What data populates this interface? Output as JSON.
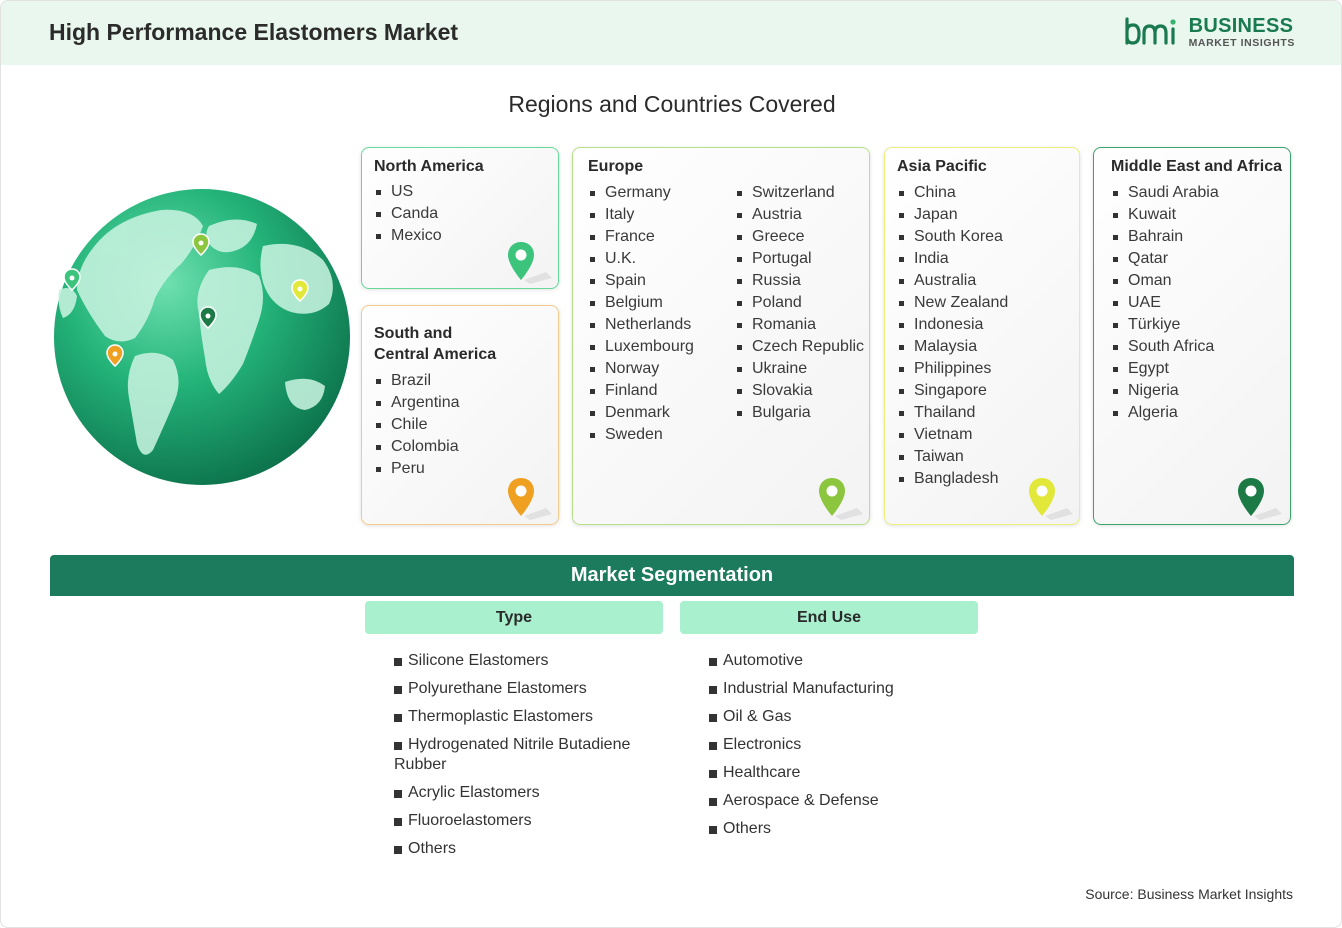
{
  "header": {
    "title": "High Performance Elastomers Market",
    "logo_line1": "BUSINESS",
    "logo_line2": "MARKET INSIGHTS",
    "logo_mark": "bmi"
  },
  "regions_title": "Regions and Countries Covered",
  "regions": {
    "north_america": {
      "title": "North America",
      "items": [
        "US",
        "Canda",
        "Mexico"
      ],
      "pin_color": "#3cc47c"
    },
    "south_america": {
      "title_line1": "South and",
      "title_line2": "Central America",
      "items": [
        "Brazil",
        "Argentina",
        "Chile",
        "Colombia",
        "Peru"
      ],
      "pin_color": "#f0a020"
    },
    "europe": {
      "title": "Europe",
      "col1": [
        "Germany",
        "Italy",
        "France",
        "U.K.",
        "Spain",
        "Belgium",
        "Netherlands",
        "Luxembourg",
        "Norway",
        "Finland",
        "Denmark",
        "Sweden"
      ],
      "col2": [
        "Switzerland",
        "Austria",
        "Greece",
        "Portugal",
        "Russia",
        "Poland",
        "Romania",
        "Czech Republic",
        "Ukraine",
        "Slovakia",
        "Bulgaria"
      ],
      "pin_color": "#8cc63f"
    },
    "asia_pacific": {
      "title": "Asia Pacific",
      "items": [
        "China",
        "Japan",
        "South Korea",
        "India",
        "Australia",
        "New Zealand",
        "Indonesia",
        "Malaysia",
        "Philippines",
        "Singapore",
        "Thailand",
        "Vietnam",
        "Taiwan",
        "Bangladesh"
      ],
      "pin_color": "#e2e83a"
    },
    "mea": {
      "title": "Middle East and Africa",
      "items": [
        "Saudi Arabia",
        "Kuwait",
        "Bahrain",
        "Qatar",
        "Oman",
        "UAE",
        "Türkiye",
        "South Africa",
        "Egypt",
        "Nigeria",
        "Algeria"
      ],
      "pin_color": "#1b7a45"
    }
  },
  "segmentation": {
    "title": "Market Segmentation",
    "type": {
      "label": "Type",
      "items": [
        "Silicone Elastomers",
        "Polyurethane Elastomers",
        "Thermoplastic Elastomers",
        "Hydrogenated Nitrile Butadiene Rubber",
        "Acrylic Elastomers",
        "Fluoroelastomers",
        "Others"
      ]
    },
    "end_use": {
      "label": "End Use",
      "items": [
        "Automotive",
        "Industrial Manufacturing",
        "Oil & Gas",
        "Electronics",
        "Healthcare",
        "Aerospace & Defense",
        "Others"
      ]
    }
  },
  "source": "Source: Business Market Insights",
  "icons": [
    "globe-icon",
    "map-pin-icon",
    "bmi-logo-icon"
  ]
}
